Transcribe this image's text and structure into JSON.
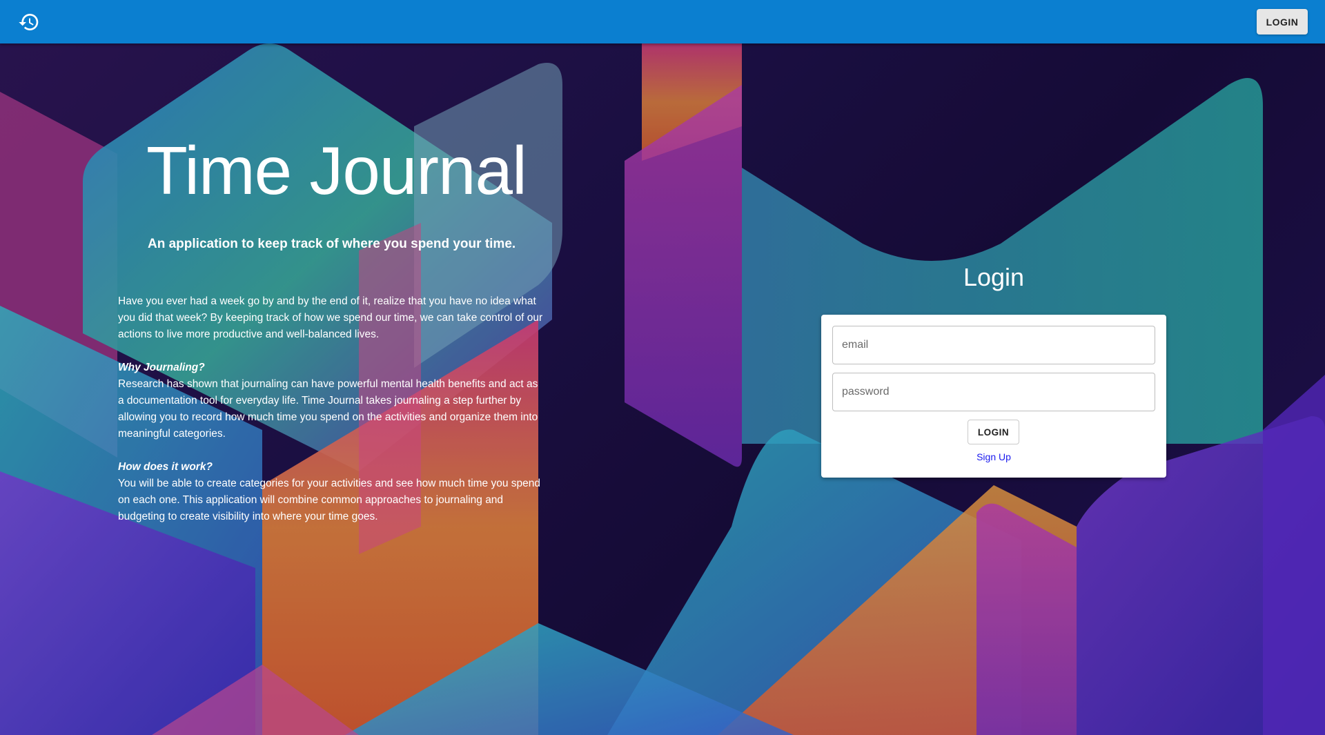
{
  "appbar": {
    "history_icon": "history-icon",
    "login_label": "LOGIN",
    "color": "#0b7fd0"
  },
  "hero": {
    "title": "Time Journal",
    "subtitle": "An application to keep track of where you spend your time.",
    "intro": "Have you ever had a week go by and by the end of it, realize that you have no idea what you did that week? By keeping track of how we spend our time, we can take control of our actions to live more productive and well-balanced lives.",
    "sections": [
      {
        "heading": "Why Journaling?",
        "text": "Research has shown that journaling can have powerful mental health benefits and act as a documentation tool for everyday life. Time Journal takes journaling a step further by allowing you to record how much time you spend on the activities and organize them into meaningful categories."
      },
      {
        "heading": "How does it work?",
        "text": "You will be able to create categories for your activities and see how much time you spend on each one. This application will combine common approaches to journaling and budgeting to create visibility into where your time goes."
      }
    ]
  },
  "login": {
    "heading": "Login",
    "email_placeholder": "email",
    "password_placeholder": "password",
    "button_label": "LOGIN",
    "signup_label": "Sign Up",
    "link_color": "#1a1aee"
  }
}
